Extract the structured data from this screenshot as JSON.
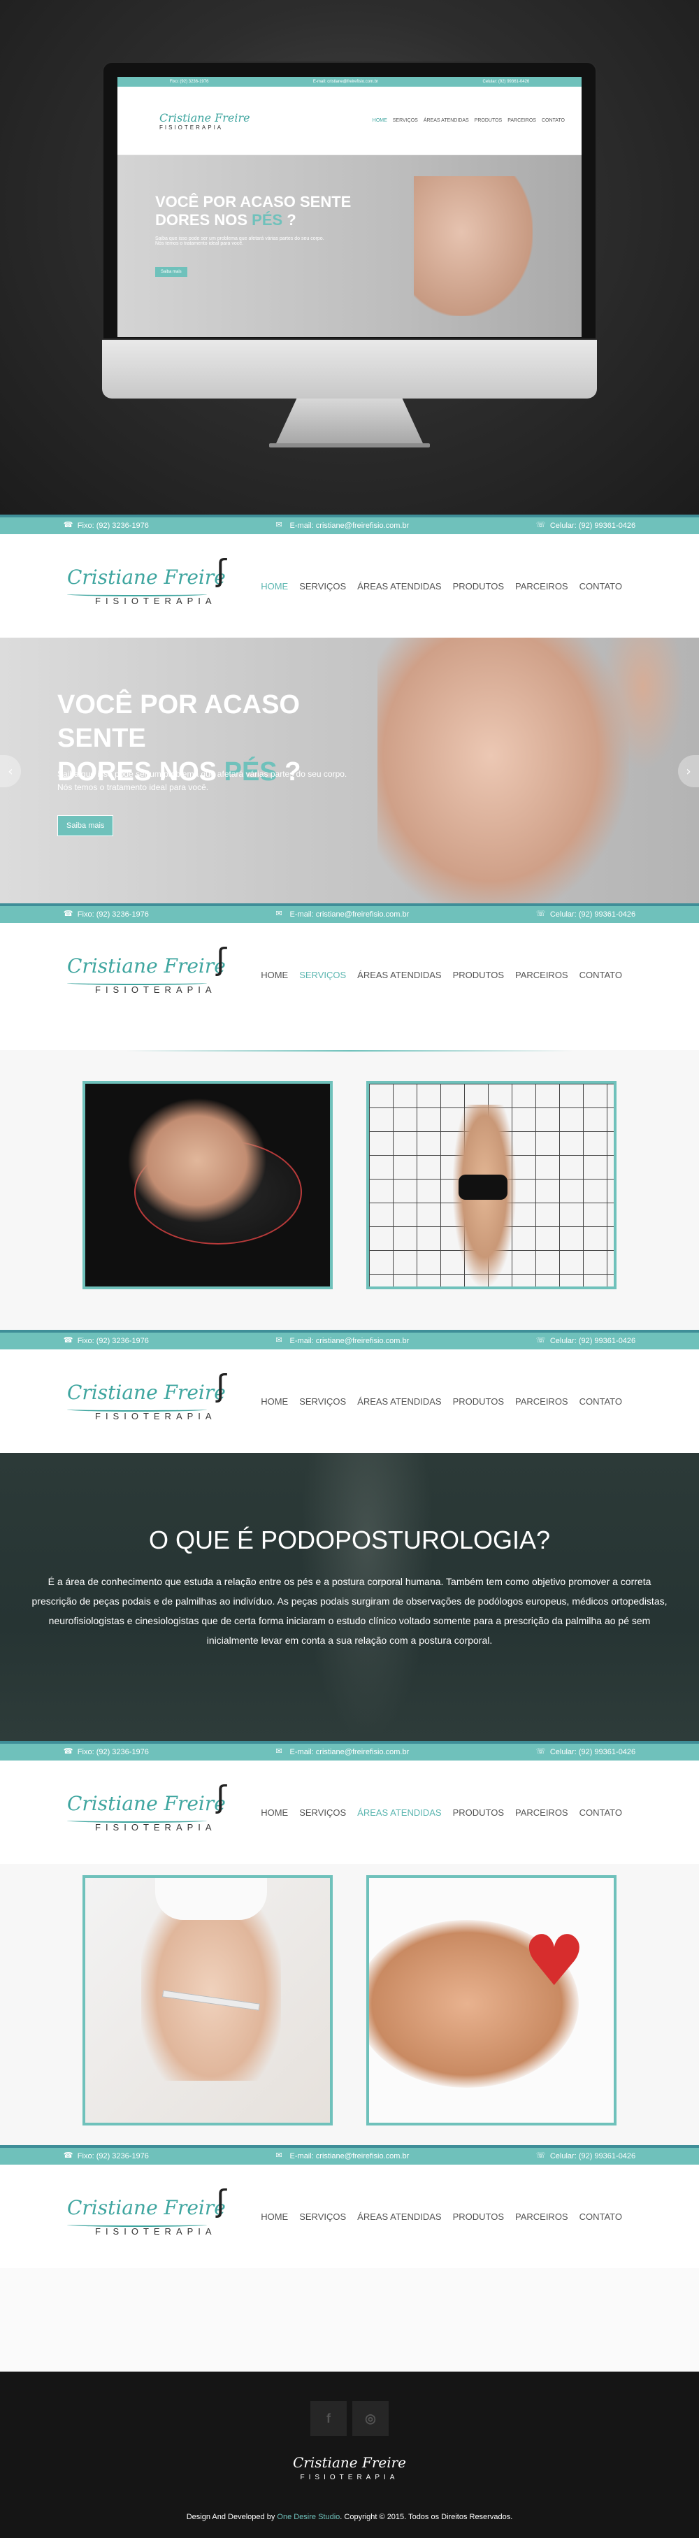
{
  "contact": {
    "phone": "Fixo: (92) 3236-1976",
    "email": "E-mail: cristiane@freirefisio.com.br",
    "mobile": "Celular: (92) 99361-0426"
  },
  "logo": {
    "script": "Cristiane Freire",
    "subtitle": "FISIOTERAPIA"
  },
  "nav": [
    "HOME",
    "SERVIÇOS",
    "ÁREAS ATENDIDAS",
    "PRODUTOS",
    "PARCEIROS",
    "CONTATO"
  ],
  "banner": {
    "title_line1": "VOCÊ POR ACASO SENTE",
    "title_line2": "DORES NOS ",
    "title_accent": "PÉS",
    "title_end": " ?",
    "text_line1": "Saiba que isso pode ser um problema que afetará várias partes do seu corpo.",
    "text_line2": "Nós temos o tratamento ideal para você.",
    "button": "Saiba mais",
    "prev": "‹",
    "next": "›"
  },
  "podoposturologia": {
    "title": "O QUE É PODOPOSTUROLOGIA?",
    "text": "É a área de conhecimento que estuda a relação entre os pés e a postura corporal humana. Também tem como objetivo promover a correta prescrição de peças podais e de palmilhas ao indivíduo. As peças podais surgiram de observações de podólogos europeus, médicos ortopedistas, neurofisiologistas e cinesiologistas que de certa forma iniciaram o estudo clínico voltado somente para a prescrição da palmilha ao pé sem inicialmente levar em conta a sua relação com a postura corporal."
  },
  "footer": {
    "social_facebook": "f",
    "social_instagram": "◎",
    "logo_script": "Cristiane Freire",
    "logo_sub": "FISIOTERAPIA",
    "credits_prefix": "Design And Developed by ",
    "credits_studio": "One Desire Studio",
    "credits_suffix": ". Copyright © 2015. Todos os Direitos Reservados."
  },
  "colors": {
    "accent": "#6fc1bb",
    "accent_dark": "#3f8e98",
    "footer_bg": "#151515"
  },
  "apple_logo": "",
  "icons": [
    "phone-icon",
    "mail-icon",
    "mobile-icon",
    "facebook-icon",
    "instagram-icon",
    "chevron-left-icon",
    "chevron-right-icon"
  ]
}
